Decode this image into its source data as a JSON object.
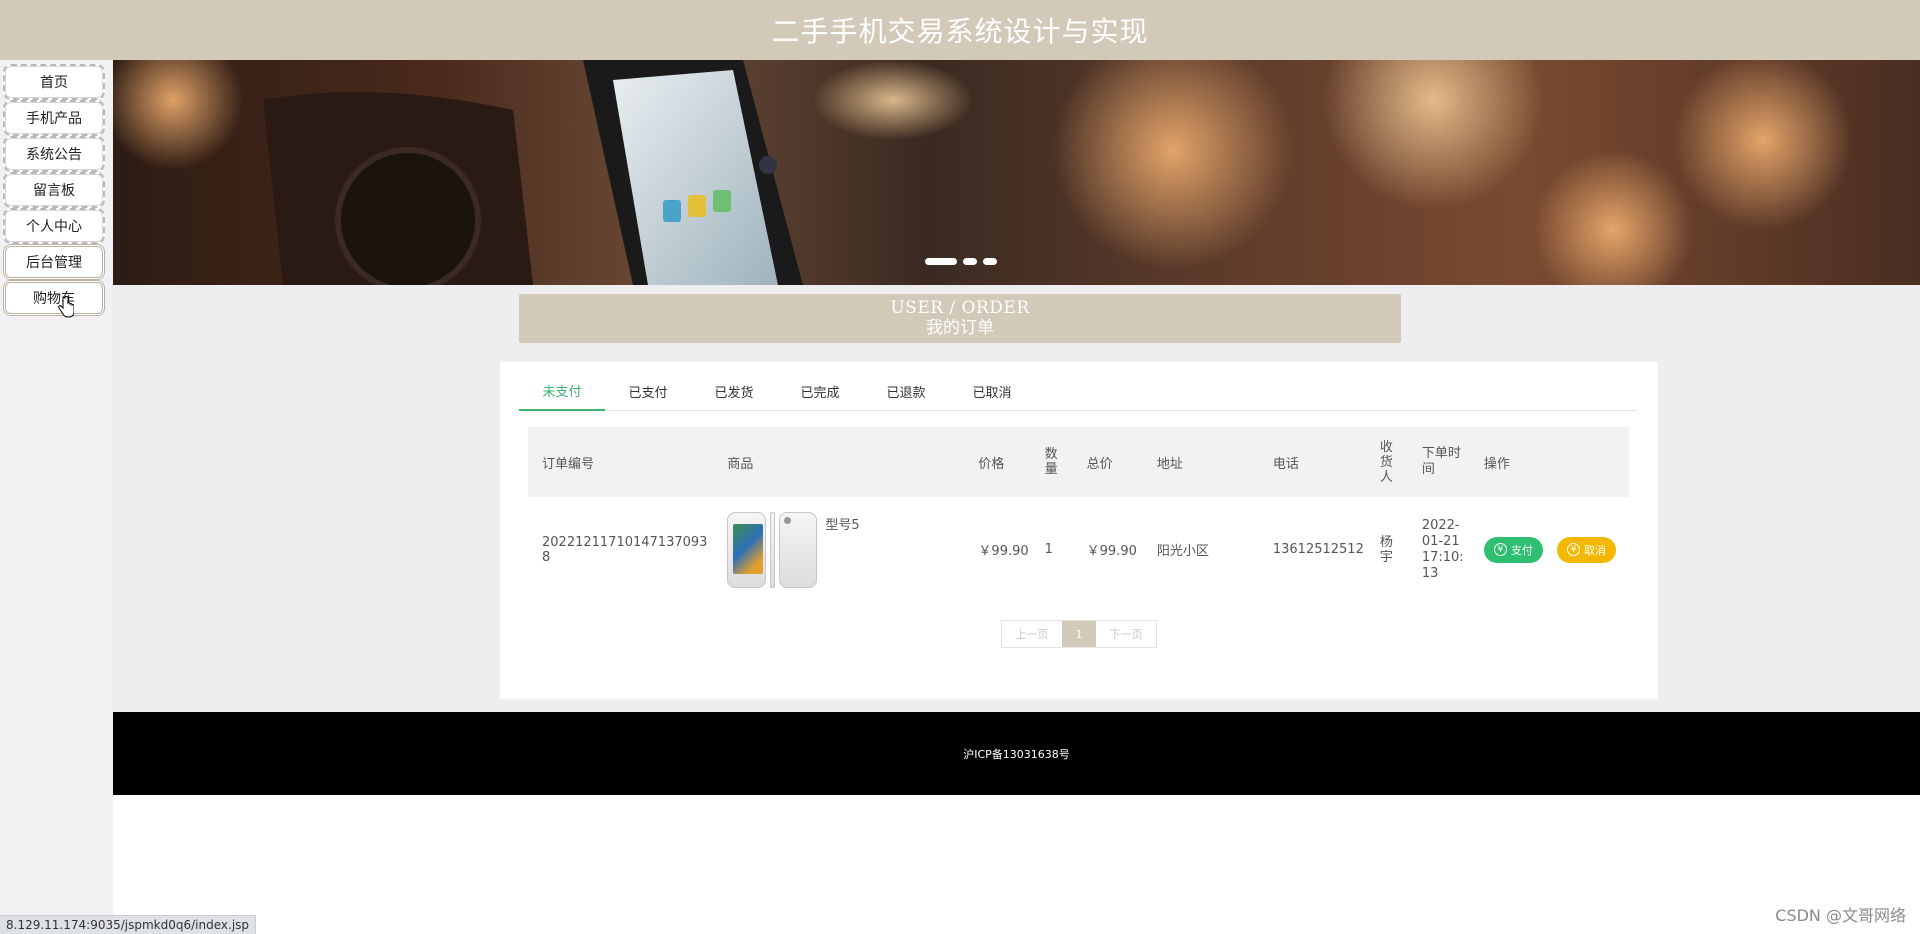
{
  "site": {
    "title": "二手手机交易系统设计与实现"
  },
  "sidebar": {
    "items": [
      {
        "label": "首页"
      },
      {
        "label": "手机产品"
      },
      {
        "label": "系统公告"
      },
      {
        "label": "留言板"
      },
      {
        "label": "个人中心"
      },
      {
        "label": "后台管理"
      },
      {
        "label": "购物车"
      }
    ]
  },
  "banner": {
    "dots": 3,
    "active_dot": 1
  },
  "section": {
    "title_en": "USER / ORDER",
    "title_zh": "我的订单"
  },
  "tabs": [
    {
      "label": "未支付",
      "active": true
    },
    {
      "label": "已支付"
    },
    {
      "label": "已发货"
    },
    {
      "label": "已完成"
    },
    {
      "label": "已退款"
    },
    {
      "label": "已取消"
    }
  ],
  "table": {
    "headers": [
      "订单编号",
      "商品",
      "价格",
      "数量",
      "总价",
      "地址",
      "电话",
      "收货人",
      "下单时间",
      "操作"
    ],
    "rows": [
      {
        "order_no": "20221211710147137093​8",
        "product": "型号5",
        "price": "￥99.90",
        "qty": "1",
        "total": "￥99.90",
        "address": "阳光小区",
        "phone": "13612512512",
        "receiver": "杨宇",
        "time": "2022-01-21 17:10:13",
        "pay_label": "支付",
        "cancel_label": "取消"
      }
    ]
  },
  "pager": {
    "prev": "上一页",
    "current": "1",
    "next": "下一页"
  },
  "footer": {
    "text": "沪ICP备13031638号"
  },
  "browser": {
    "status_url": "8.129.11.174:9035/jspmkd0q6/index.jsp"
  },
  "watermark": "CSDN @文哥网络",
  "colors": {
    "header": "#d2c9b8",
    "active_tab": "#3cb371",
    "pay": "#2fbf71",
    "cancel": "#f5b800"
  }
}
